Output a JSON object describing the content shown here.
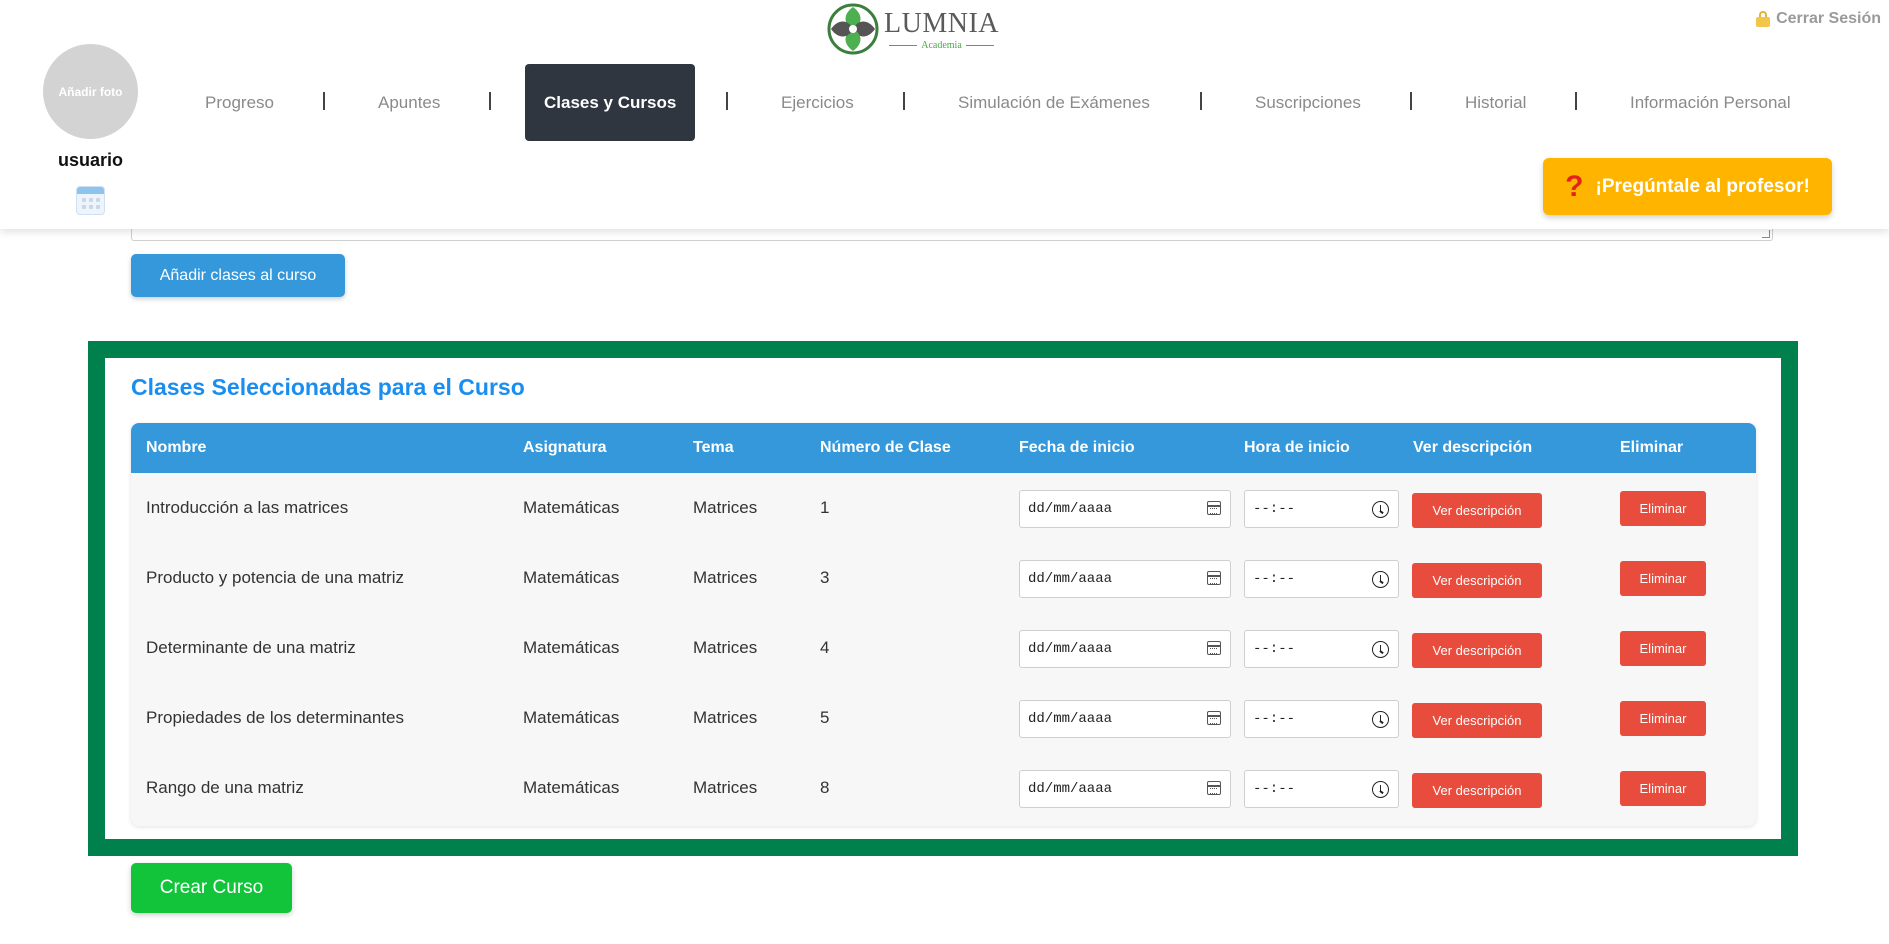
{
  "header": {
    "logo": {
      "name": "LUMNIA",
      "subtitle": "Academia"
    },
    "logout_label": "Cerrar Sesión",
    "avatar_label": "Añadir foto",
    "username": "usuario",
    "ask_button_label": "¡Pregúntale al profesor!",
    "ask_icon": "?"
  },
  "nav": {
    "separator": "|",
    "items": [
      {
        "label": "Progreso",
        "active": false
      },
      {
        "label": "Apuntes",
        "active": false
      },
      {
        "label": "Clases y Cursos",
        "active": true
      },
      {
        "label": "Ejercicios",
        "active": false
      },
      {
        "label": "Simulación de Exámenes",
        "active": false
      },
      {
        "label": "Suscripciones",
        "active": false
      },
      {
        "label": "Historial",
        "active": false
      },
      {
        "label": "Información Personal",
        "active": false
      }
    ]
  },
  "actions": {
    "add_classes_label": "Añadir clases al curso",
    "create_course_label": "Crear Curso"
  },
  "selected": {
    "title": "Clases Seleccionadas para el Curso",
    "columns": [
      "Nombre",
      "Asignatura",
      "Tema",
      "Número de Clase",
      "Fecha de inicio",
      "Hora de inicio",
      "Ver descripción",
      "Eliminar"
    ],
    "date_placeholder": "dd/mm/aaaa",
    "time_placeholder": "--:--",
    "desc_button_label": "Ver descripción",
    "delete_button_label": "Eliminar",
    "rows": [
      {
        "nombre": "Introducción a las matrices",
        "asignatura": "Matemáticas",
        "tema": "Matrices",
        "numero": "1"
      },
      {
        "nombre": "Producto y potencia de una matriz",
        "asignatura": "Matemáticas",
        "tema": "Matrices",
        "numero": "3"
      },
      {
        "nombre": "Determinante de una matriz",
        "asignatura": "Matemáticas",
        "tema": "Matrices",
        "numero": "4"
      },
      {
        "nombre": "Propiedades de los determinantes",
        "asignatura": "Matemáticas",
        "tema": "Matrices",
        "numero": "5"
      },
      {
        "nombre": "Rango de una matriz",
        "asignatura": "Matemáticas",
        "tema": "Matrices",
        "numero": "8"
      }
    ]
  },
  "colors": {
    "accent_blue": "#3498db",
    "title_blue": "#1a8ef0",
    "danger_red": "#e74c3c",
    "success_green": "#12c43a",
    "frame_green": "#00804d",
    "ask_yellow": "#ffb400",
    "nav_active": "#2f3640"
  }
}
